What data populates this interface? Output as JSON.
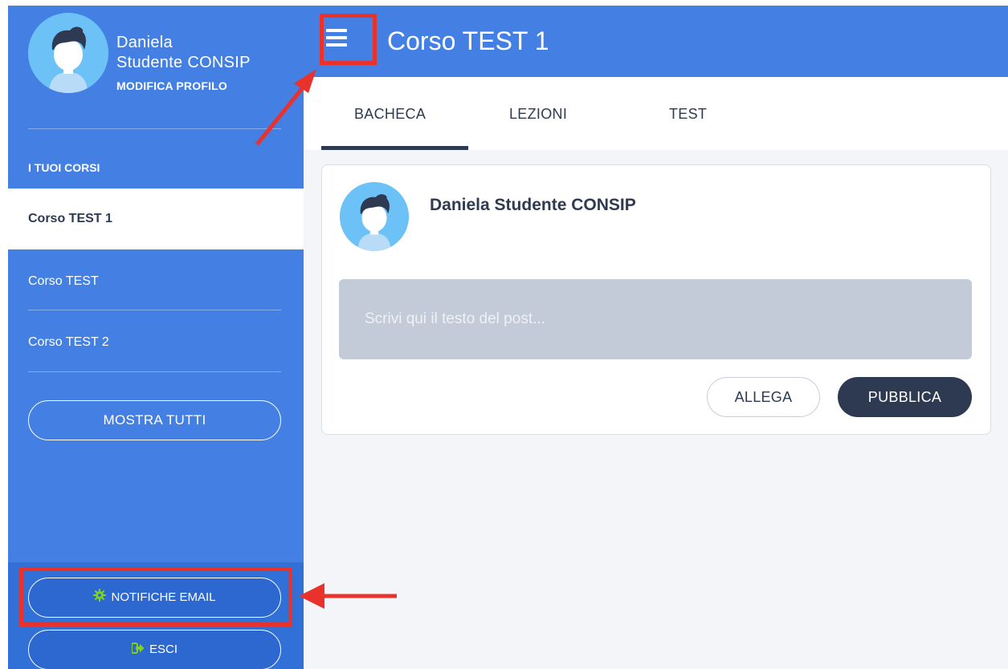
{
  "sidebar": {
    "user_first_name": "Daniela",
    "user_last_name": "Studente CONSIP",
    "edit_profile": "MODIFICA PROFILO",
    "section_title": "I TUOI CORSI",
    "courses": [
      {
        "label": "Corso TEST 1",
        "active": true
      },
      {
        "label": "Corso TEST",
        "active": false
      },
      {
        "label": "Corso TEST 2",
        "active": false
      }
    ],
    "show_all": "MOSTRA TUTTI",
    "email_notifications": "NOTIFICHE EMAIL",
    "email_notifications_icon": "gear-icon",
    "logout": "ESCI",
    "logout_icon": "sign-out-icon"
  },
  "header": {
    "menu_icon": "hamburger-menu-icon",
    "title": "Corso TEST 1"
  },
  "tabs": [
    {
      "label": "BACHECA",
      "active": true
    },
    {
      "label": "LEZIONI",
      "active": false
    },
    {
      "label": "TEST",
      "active": false
    }
  ],
  "post_card": {
    "author": "Daniela Studente CONSIP",
    "placeholder": "Scrivi qui il testo del post...",
    "attach_label": "ALLEGA",
    "publish_label": "PUBBLICA"
  },
  "colors": {
    "primary_blue": "#4480e4",
    "dark_navy": "#2d3a52",
    "annotation_red": "#e8322b",
    "icon_green": "#7ed321"
  }
}
